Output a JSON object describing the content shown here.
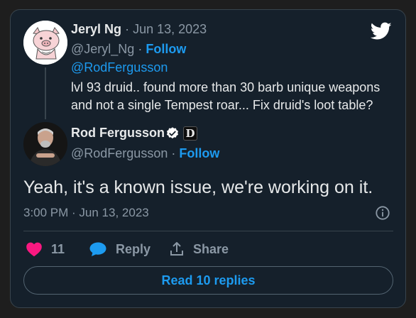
{
  "reply_tweet": {
    "author_name": "Jeryl Ng",
    "separator": "·",
    "date": "Jun 13, 2023",
    "handle": "@Jeryl_Ng",
    "follow_label": "Follow",
    "mention": "@RodFergusson",
    "body_line_1": "lvl 93 druid.. found more than 30 barb unique weapons",
    "body_line_2": "and not a single Tempest roar... Fix druid's loot table?"
  },
  "main_tweet": {
    "author_name": "Rod Fergusson",
    "handle": "@RodFergusson",
    "follow_label": "Follow",
    "badge_letter": "D",
    "text": "Yeah, it's a known issue, we're working on it.",
    "timestamp": "3:00 PM · Jun 13, 2023"
  },
  "actions": {
    "like_count": "11",
    "reply_label": "Reply",
    "share_label": "Share"
  },
  "read_replies_label": "Read 10 replies",
  "icons": {
    "brand": "twitter-bird-icon",
    "verified": "verified-badge-icon",
    "info": "info-icon",
    "like": "heart-icon",
    "reply": "speech-bubble-icon",
    "share": "share-icon"
  },
  "colors": {
    "background": "#15202b",
    "accent": "#1d9bf0",
    "like": "#f91880",
    "muted": "#8b98a5",
    "text": "#e7e9ea",
    "border": "#38444d"
  }
}
